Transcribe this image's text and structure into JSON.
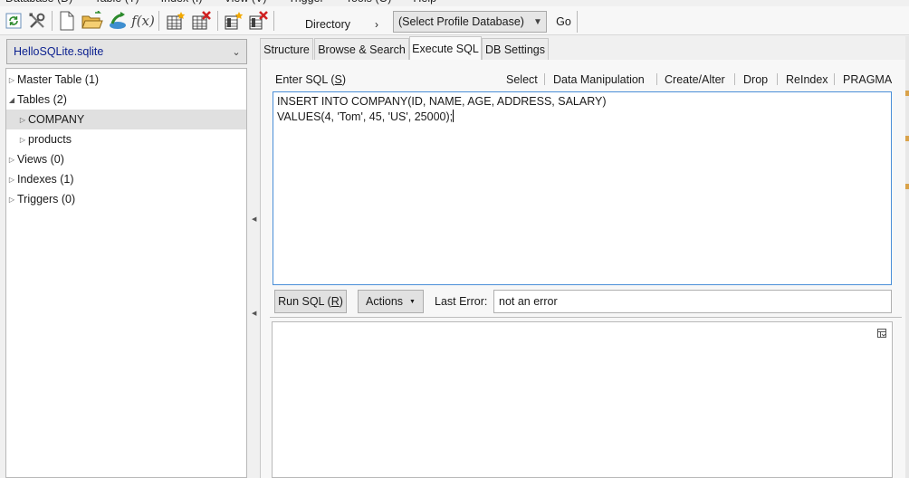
{
  "menu": [
    "Database (D)",
    "Table (T)",
    "Index (I)",
    "View (V)",
    "Trigger",
    "Tools (O)",
    "Help"
  ],
  "toolbar": {
    "icons": [
      "refresh-icon",
      "tools-icon",
      "new-db-icon",
      "open-db-icon",
      "attach-db-icon",
      "function-icon",
      "create-table-icon",
      "drop-table-icon",
      "create-index-icon",
      "drop-index-icon"
    ],
    "function_label": "f(x)",
    "directory_label": "Directory",
    "directory_arrow": "›",
    "profile_select": "(Select Profile Database)",
    "go_label": "Go"
  },
  "sidebar": {
    "database": "HelloSQLite.sqlite",
    "tree": [
      {
        "label": "Master Table (1)",
        "expanded": false
      },
      {
        "label": "Tables (2)",
        "expanded": true
      },
      {
        "label": "COMPANY",
        "expanded": false,
        "selected": true
      },
      {
        "label": "products",
        "expanded": false
      },
      {
        "label": "Views (0)",
        "expanded": false
      },
      {
        "label": "Indexes (1)",
        "expanded": false
      },
      {
        "label": "Triggers (0)",
        "expanded": false
      }
    ]
  },
  "tabs": [
    {
      "label": "Structure",
      "active": false
    },
    {
      "label": "Browse & Search",
      "active": false
    },
    {
      "label": "Execute SQL",
      "active": true
    },
    {
      "label": "DB Settings",
      "active": false
    }
  ],
  "execute": {
    "enter_sql_label": "Enter SQL (",
    "enter_sql_key": "S",
    "enter_sql_end": ")",
    "links": [
      "Select",
      "Data Manipulation",
      "Create/Alter",
      "Drop",
      "ReIndex",
      "PRAGMA"
    ],
    "sql_lines": [
      "INSERT INTO COMPANY(ID, NAME, AGE, ADDRESS, SALARY)",
      "VALUES(4, 'Tom', 45, 'US', 25000);"
    ],
    "run_label": "Run SQL (",
    "run_key": "R",
    "run_end": ")",
    "actions_label": "Actions",
    "last_error_label": "Last Error:",
    "last_error_value": "not an error"
  },
  "colors": {
    "accent": "#4a8fd8",
    "db_name": "#0a1f8f",
    "selection": "#e0e0e0"
  }
}
